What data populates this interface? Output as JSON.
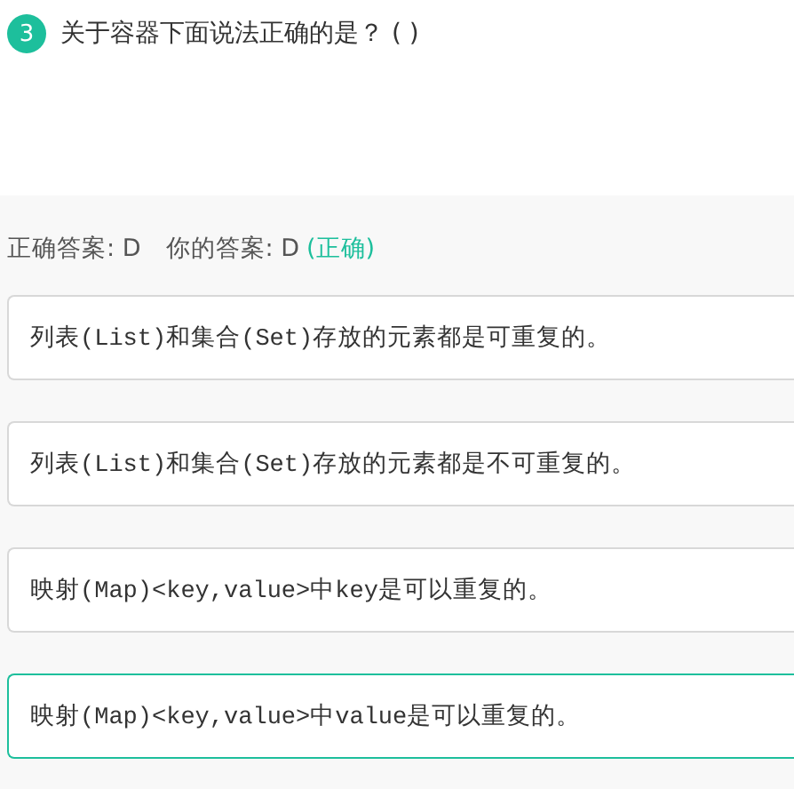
{
  "question": {
    "number": "3",
    "text": "关于容器下面说法正确的是？ ( )"
  },
  "result": {
    "correct_label": "正确答案: D",
    "your_label": "你的答案: D",
    "verdict": "(正确)",
    "correct": true
  },
  "options": [
    {
      "selected": false,
      "text": "列表(List)和集合(Set)存放的元素都是可重复的。"
    },
    {
      "selected": false,
      "text": "列表(List)和集合(Set)存放的元素都是不可重复的。"
    },
    {
      "selected": false,
      "text": "映射(Map)<key,value>中key是可以重复的。"
    },
    {
      "selected": true,
      "text": "映射(Map)<key,value>中value是可以重复的。"
    }
  ]
}
